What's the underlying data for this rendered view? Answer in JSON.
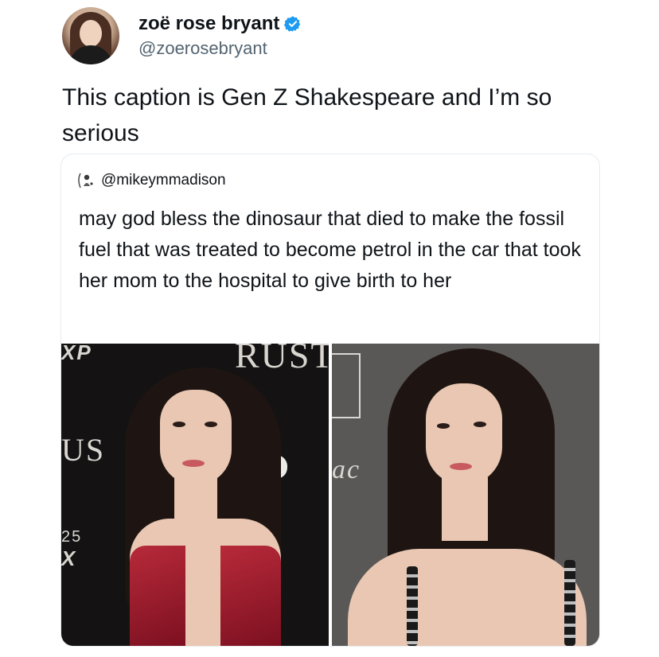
{
  "author": {
    "display_name": "zoë rose bryant",
    "handle": "@zoerosebryant",
    "verified": true,
    "verified_color": "#1d9bf0",
    "avatar_icon": "profile-photo"
  },
  "tweet": {
    "text": "This caption is Gen Z Shakespeare and I’m so serious"
  },
  "quote": {
    "handle": "@mikeymmadison",
    "avatar_icon": "profile-photo",
    "text": "may god bless the dinosaur that died to make the fossil fuel that was treated to become petrol in the car that took her mom to the hospital to give birth to her",
    "images": [
      {
        "name": "photo-left",
        "backdrop_text": [
          "XP",
          "RUST",
          "US",
          "25",
          "X"
        ]
      },
      {
        "name": "photo-right",
        "backdrop_text": [
          "ac"
        ]
      }
    ]
  }
}
